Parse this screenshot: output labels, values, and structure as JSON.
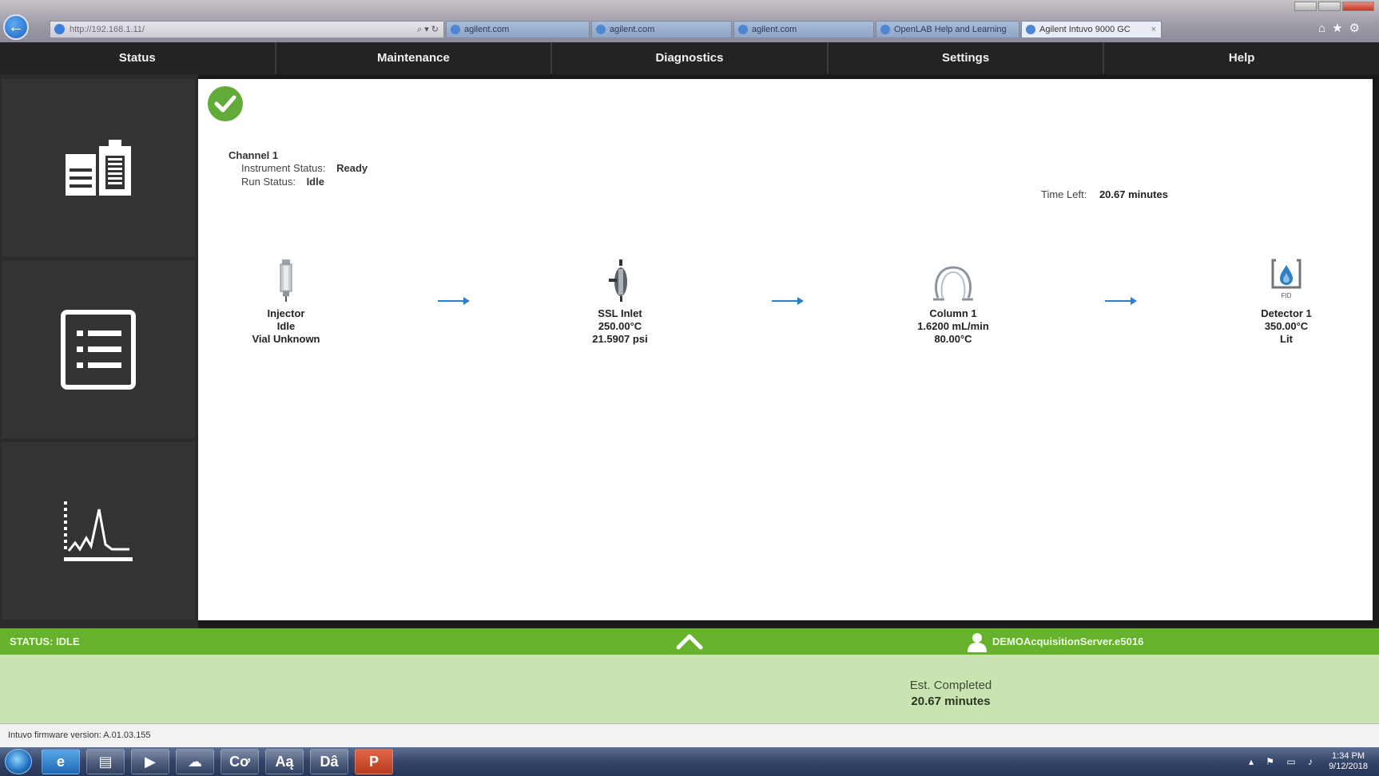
{
  "browser": {
    "address": "http://192.168.1.11/",
    "address_tools": "⌕ ▾ ↻",
    "tabs": [
      {
        "label": "agilent.com"
      },
      {
        "label": "agilent.com"
      },
      {
        "label": "agilent.com"
      },
      {
        "label": "OpenLAB Help and Learning"
      },
      {
        "label": "Agilent Intuvo 9000 GC",
        "active": true,
        "close": "×"
      }
    ],
    "right_icons": "⌂★⚙"
  },
  "nav": {
    "items": [
      "Status",
      "Maintenance",
      "Diagnostics",
      "Settings",
      "Help"
    ]
  },
  "channel": {
    "title": "Channel 1",
    "instrument_status_label": "Instrument Status:",
    "instrument_status_value": "Ready",
    "run_status_label": "Run Status:",
    "run_status_value": "Idle"
  },
  "time_left": {
    "label": "Time Left:",
    "value": "20.67 minutes"
  },
  "flow": {
    "injector": {
      "name": "Injector",
      "line2": "Idle",
      "line3": "Vial Unknown"
    },
    "inlet": {
      "name": "SSL Inlet",
      "line2": "250.00°C",
      "line3": "21.5907 psi"
    },
    "column": {
      "name": "Column 1",
      "line2": "1.6200 mL/min",
      "line3": "80.00°C"
    },
    "detector": {
      "name": "Detector 1",
      "line2": "350.00°C",
      "line3": "Lit",
      "badge": "FID"
    }
  },
  "status_bar": {
    "status": "STATUS: IDLE",
    "server": "DEMOAcquisitionServer.e5016"
  },
  "info": {
    "est_label": "Est. Completed",
    "est_value": "20.67 minutes"
  },
  "firmware": "Intuvo firmware version: A.01.03.155",
  "taskbar": {
    "buttons": [
      "e",
      "▤",
      "▶",
      "☁",
      "Cơ",
      "Aą",
      "Dâ",
      "P"
    ],
    "tray_icons": "▴ ⚑ ▭ ♪",
    "time": "1:34 PM",
    "date": "9/12/2018"
  },
  "colors": {
    "status_green": "#67b22c",
    "info_panel": "#c9e4b1",
    "ok_icon": "#62ab38",
    "arrow_blue": "#2f7fc4",
    "nav_bg": "#232323"
  }
}
